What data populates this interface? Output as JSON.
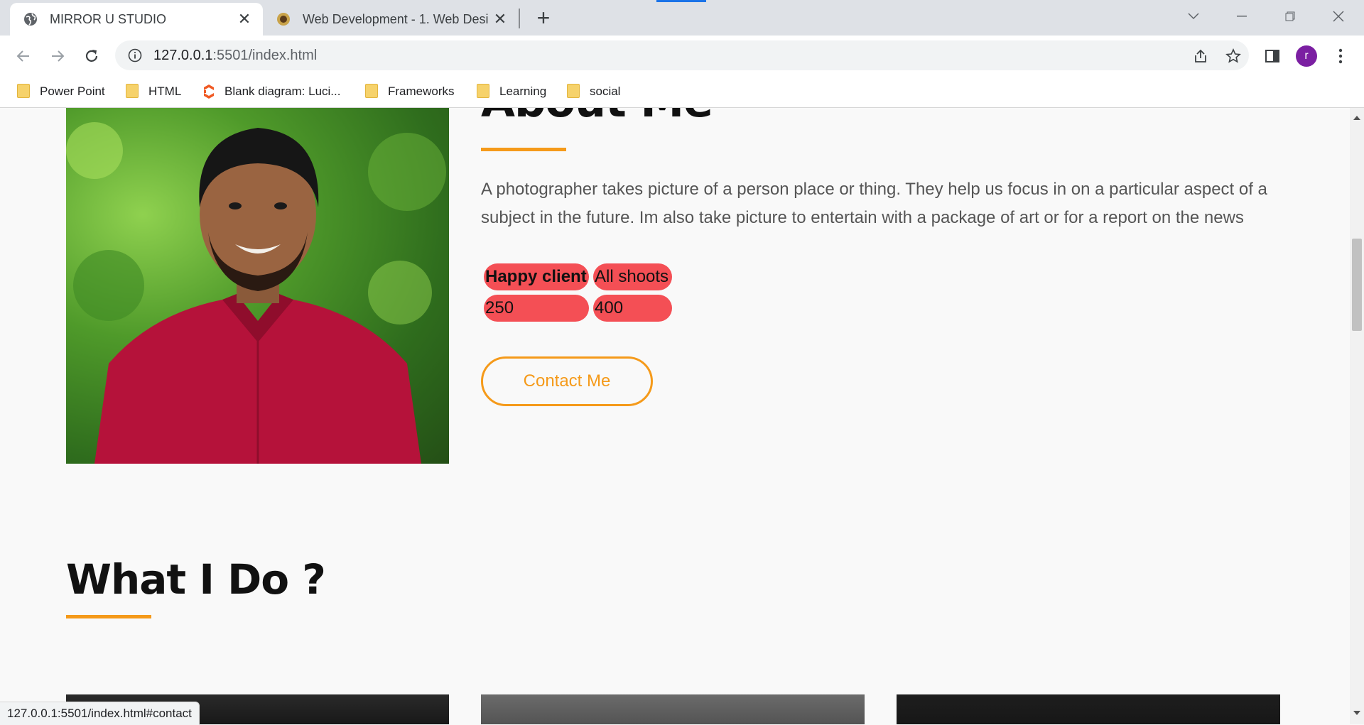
{
  "browser": {
    "tabs": [
      {
        "title": "MIRROR U STUDIO",
        "active": true
      },
      {
        "title": "Web Development - 1. Web Desi",
        "active": false
      }
    ],
    "url_host": "127.0.0.1",
    "url_rest": ":5501/index.html",
    "profile_initial": "r",
    "bookmarks": [
      {
        "label": "Power Point",
        "icon": "folder-icon"
      },
      {
        "label": "HTML",
        "icon": "folder-icon"
      },
      {
        "label": "Blank diagram: Luci...",
        "icon": "lucid-icon"
      },
      {
        "label": "Frameworks",
        "icon": "folder-icon"
      },
      {
        "label": "Learning",
        "icon": "folder-icon"
      },
      {
        "label": "social",
        "icon": "folder-icon"
      }
    ],
    "status_url": "127.0.0.1:5501/index.html#contact"
  },
  "about": {
    "heading": "About Me",
    "text": "A photographer takes picture of a person place or thing. They help us focus in on a particular aspect of a subject in the future. Im also take picture to entertain with a package of art or for a report on the news",
    "stats": {
      "headers": [
        "Happy client",
        "All shoots"
      ],
      "values": [
        "250",
        "400"
      ]
    },
    "contact_button": "Contact Me"
  },
  "services": {
    "heading": "What I Do ?"
  },
  "colors": {
    "accent": "#f59a1a",
    "stat_background": "#f44f55",
    "profile": "#7b1fa2"
  }
}
